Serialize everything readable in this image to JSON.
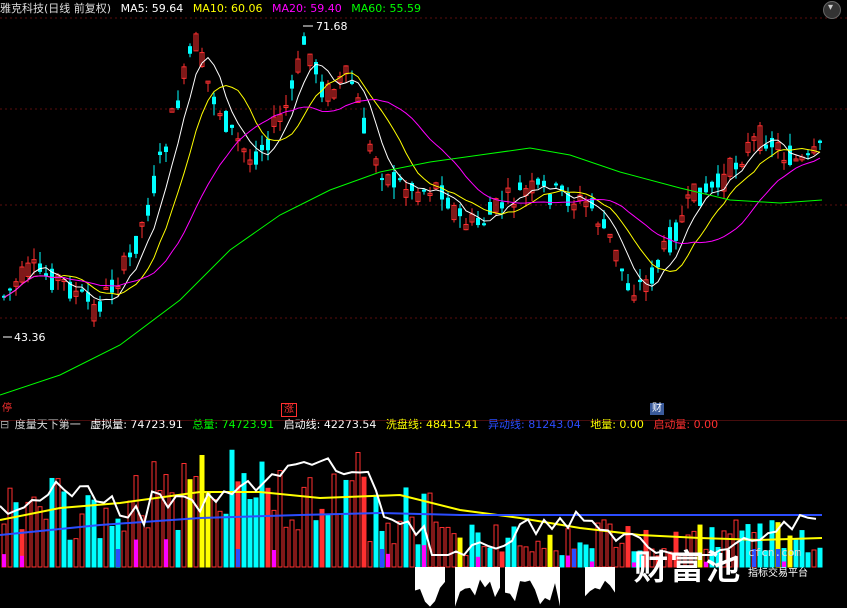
{
  "header": {
    "title": "雅克科技(日线 前复权)",
    "ma": [
      {
        "label": "MA5: 59.64",
        "color": "#ffffff"
      },
      {
        "label": "MA10: 60.06",
        "color": "#ffff00"
      },
      {
        "label": "MA20: 59.40",
        "color": "#ff00ff"
      },
      {
        "label": "MA60: 55.59",
        "color": "#00ff00"
      }
    ]
  },
  "price_chart": {
    "high_label": "71.68",
    "low_label": "43.36",
    "markers": [
      {
        "text": "停",
        "color": "#ff3030"
      },
      {
        "text": "涨",
        "color": "#ff3030"
      },
      {
        "text": "财",
        "color": "#ffffff"
      }
    ]
  },
  "indicator": {
    "name": "度量天下第一",
    "items": [
      {
        "label": "虚拟量: 74723.91",
        "color": "#ffffff"
      },
      {
        "label": "总量: 74723.91",
        "color": "#00ff00"
      },
      {
        "label": "启动线: 42273.54",
        "color": "#ffffff"
      },
      {
        "label": "洗盘线: 48415.41",
        "color": "#ffff00"
      },
      {
        "label": "异动线: 81243.04",
        "color": "#2b4dff"
      },
      {
        "label": "地量: 0.00",
        "color": "#ffff00"
      },
      {
        "label": "启动量: 0.00",
        "color": "#ff3030"
      }
    ]
  },
  "watermark": {
    "brand": "财富池",
    "url": "cfcn.com",
    "slogan": "指标交易平台"
  },
  "chart_data": {
    "type": "candlestick",
    "y_range": [
      43.36,
      71.68
    ],
    "ma_periods": [
      5,
      10,
      20,
      60
    ],
    "colors": {
      "up": "#ff3030",
      "down": "#00ffff",
      "ma5": "#ffffff",
      "ma10": "#ffff00",
      "ma20": "#ff00ff",
      "ma60": "#00ff00"
    }
  }
}
